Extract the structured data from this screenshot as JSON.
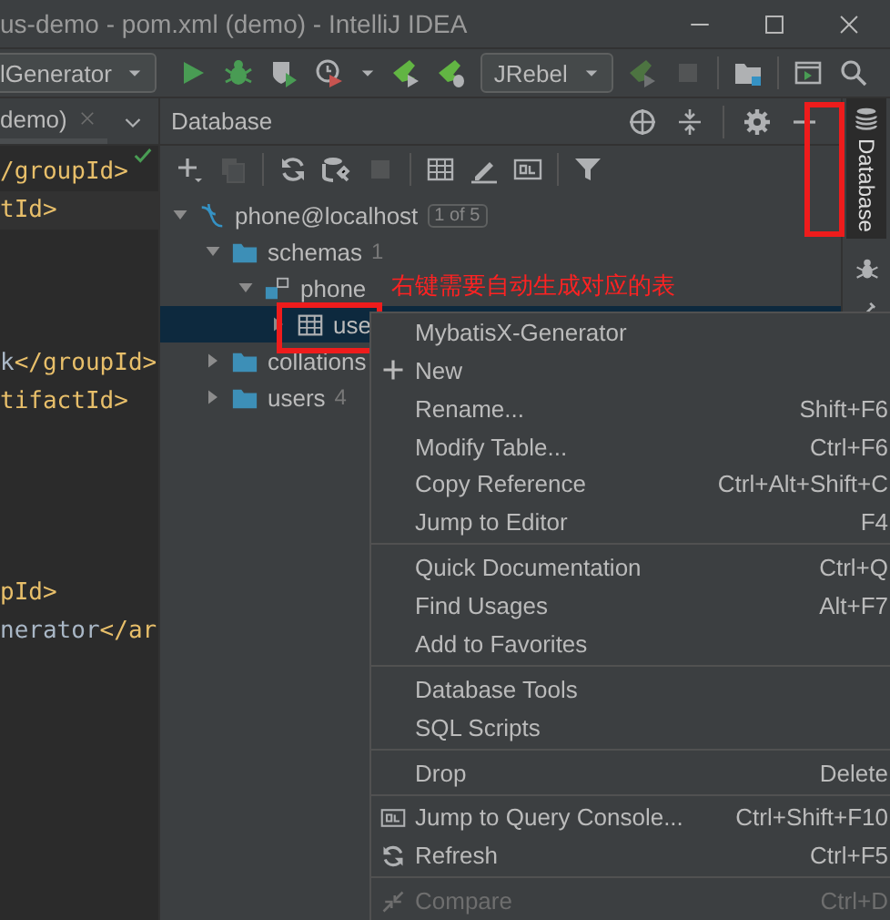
{
  "window": {
    "title": "us-demo - pom.xml (demo) - IntelliJ IDEA",
    "controls": [
      {
        "kind": "minimize"
      },
      {
        "kind": "maximize"
      },
      {
        "kind": "close"
      }
    ]
  },
  "toolbar": [
    {
      "kind": "dropdown",
      "label": "lGenerator",
      "disabled": false
    },
    {
      "kind": "run",
      "disabled": false
    },
    {
      "kind": "debug",
      "disabled": false
    },
    {
      "kind": "coverage",
      "disabled": false
    },
    {
      "kind": "profile",
      "disabled": false
    },
    {
      "kind": "jrebel-run",
      "disabled": false
    },
    {
      "kind": "jrebel-debug",
      "disabled": false
    },
    {
      "kind": "dropdown",
      "label": "JRebel",
      "disabled": false
    },
    {
      "kind": "jrebel-run",
      "disabled": true
    },
    {
      "kind": "stop",
      "disabled": true
    },
    {
      "kind": "separator",
      "disabled": false
    },
    {
      "kind": "folder",
      "disabled": false
    },
    {
      "kind": "separator",
      "disabled": false
    },
    {
      "kind": "console",
      "disabled": false
    },
    {
      "kind": "search",
      "disabled": false
    }
  ],
  "editor": {
    "tab": {
      "label": "demo)",
      "selected": true
    },
    "lines": [
      {
        "kind": "code",
        "segments": [
          {
            "kind": "tag",
            "text": "/groupId>"
          }
        ]
      },
      {
        "kind": "current",
        "segments": [
          {
            "kind": "tag",
            "text": "tId>"
          }
        ]
      },
      {
        "kind": "blank"
      },
      {
        "kind": "blank"
      },
      {
        "kind": "blank"
      },
      {
        "kind": "code",
        "segments": [
          {
            "kind": "text",
            "text": "k"
          },
          {
            "kind": "tag",
            "text": "</groupId>"
          }
        ]
      },
      {
        "kind": "code",
        "segments": [
          {
            "kind": "tag",
            "text": "tifactId>"
          }
        ]
      },
      {
        "kind": "blank"
      },
      {
        "kind": "blank"
      },
      {
        "kind": "blank"
      },
      {
        "kind": "blank"
      },
      {
        "kind": "code",
        "segments": [
          {
            "kind": "tag",
            "text": "pId>"
          }
        ]
      },
      {
        "kind": "code",
        "segments": [
          {
            "kind": "text",
            "text": "nerator"
          },
          {
            "kind": "tag",
            "text": "</ar"
          }
        ]
      }
    ]
  },
  "database": {
    "title": "Database",
    "header_actions": [
      {
        "kind": "locate"
      },
      {
        "kind": "collapse"
      },
      {
        "kind": "separator"
      },
      {
        "kind": "settings"
      },
      {
        "kind": "hide"
      }
    ],
    "toolbar": [
      {
        "kind": "add",
        "disabled": false
      },
      {
        "kind": "copy",
        "disabled": true
      },
      {
        "kind": "separator",
        "disabled": false
      },
      {
        "kind": "refresh",
        "disabled": false
      },
      {
        "kind": "tools",
        "disabled": false
      },
      {
        "kind": "stop",
        "disabled": true
      },
      {
        "kind": "separator",
        "disabled": false
      },
      {
        "kind": "table",
        "disabled": false
      },
      {
        "kind": "edit",
        "disabled": false
      },
      {
        "kind": "console",
        "disabled": false
      },
      {
        "kind": "separator",
        "disabled": false
      },
      {
        "kind": "filter",
        "disabled": false
      }
    ],
    "tree": [
      {
        "kind": "datasource",
        "label": "phone@localhost",
        "badge": "1 of 5",
        "expanded": true,
        "selected": false,
        "children": [
          {
            "kind": "folder",
            "label": "schemas",
            "count": "1",
            "expanded": true,
            "selected": false,
            "children": [
              {
                "kind": "schema",
                "label": "phone",
                "expanded": true,
                "selected": false,
                "children": [
                  {
                    "kind": "table",
                    "label": "use",
                    "expanded": false,
                    "selected": true
                  }
                ]
              }
            ]
          },
          {
            "kind": "folder",
            "label": "collations",
            "expanded": false,
            "selected": false
          },
          {
            "kind": "folder",
            "label": "users",
            "count": "4",
            "expanded": false,
            "selected": false
          }
        ]
      }
    ]
  },
  "annotation": {
    "text": "右键需要自动生成对应的表"
  },
  "side_strip": [
    {
      "kind": "tool-window",
      "label": "Database",
      "selected": true
    },
    {
      "kind": "ant"
    },
    {
      "kind": "pen"
    }
  ],
  "context_menu": [
    {
      "kind": "item",
      "label": "MybatisX-Generator",
      "disabled": false
    },
    {
      "kind": "new",
      "label": "New",
      "disabled": false
    },
    {
      "kind": "item",
      "label": "Rename...",
      "shortcut": "Shift+F6",
      "disabled": false
    },
    {
      "kind": "item",
      "label": "Modify Table...",
      "shortcut": "Ctrl+F6",
      "disabled": false
    },
    {
      "kind": "item",
      "label": "Copy Reference",
      "shortcut": "Ctrl+Alt+Shift+C",
      "disabled": false
    },
    {
      "kind": "item",
      "label": "Jump to Editor",
      "shortcut": "F4",
      "disabled": false
    },
    {
      "kind": "separator"
    },
    {
      "kind": "item",
      "label": "Quick Documentation",
      "shortcut": "Ctrl+Q",
      "disabled": false
    },
    {
      "kind": "item",
      "label": "Find Usages",
      "shortcut": "Alt+F7",
      "disabled": false
    },
    {
      "kind": "item",
      "label": "Add to Favorites",
      "disabled": false
    },
    {
      "kind": "separator"
    },
    {
      "kind": "item",
      "label": "Database Tools",
      "disabled": false
    },
    {
      "kind": "item",
      "label": "SQL Scripts",
      "disabled": false
    },
    {
      "kind": "separator"
    },
    {
      "kind": "item",
      "label": "Drop",
      "shortcut": "Delete",
      "disabled": false
    },
    {
      "kind": "separator"
    },
    {
      "kind": "console",
      "label": "Jump to Query Console...",
      "shortcut": "Ctrl+Shift+F10",
      "disabled": false
    },
    {
      "kind": "refresh",
      "label": "Refresh",
      "shortcut": "Ctrl+F5",
      "disabled": false
    },
    {
      "kind": "separator"
    },
    {
      "kind": "compare",
      "label": "Compare",
      "shortcut": "Ctrl+D",
      "disabled": true
    }
  ]
}
